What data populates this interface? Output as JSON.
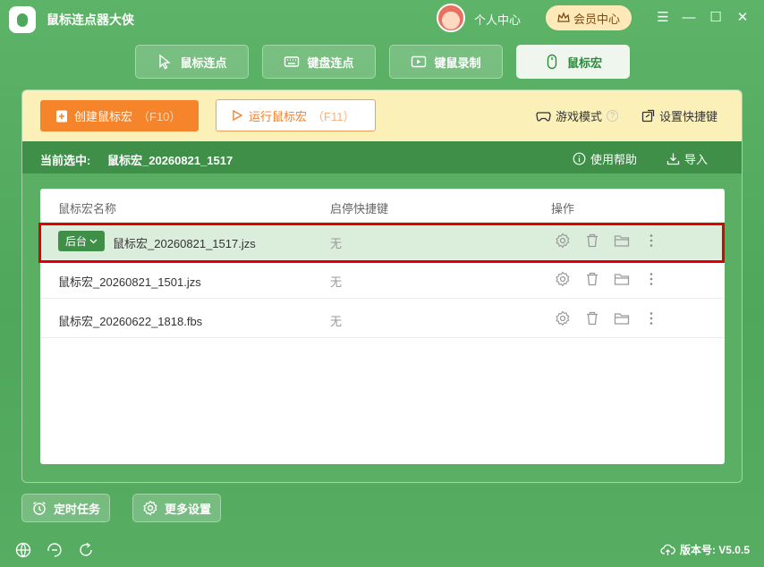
{
  "app": {
    "title": "鼠标连点器大侠",
    "user_center": "个人中心",
    "vip_label": "会员中心"
  },
  "window_controls": {
    "menu": "☰",
    "minimize": "—",
    "maximize": "☐",
    "close": "✕"
  },
  "tabs": [
    {
      "label": "鼠标连点",
      "icon": "cursor-icon"
    },
    {
      "label": "键盘连点",
      "icon": "keyboard-icon"
    },
    {
      "label": "键鼠录制",
      "icon": "video-icon"
    },
    {
      "label": "鼠标宏",
      "icon": "mouse-icon",
      "active": true
    }
  ],
  "toolbar": {
    "create_label": "创建鼠标宏",
    "create_hotkey": "（F10）",
    "run_label": "运行鼠标宏",
    "run_hotkey": "（F11）",
    "game_mode": "游戏模式",
    "game_mode_help": "?",
    "shortcut_settings": "设置快捷键"
  },
  "selection_bar": {
    "label": "当前选中:",
    "value": "鼠标宏_20260821_1517",
    "help": "使用帮助",
    "import": "导入"
  },
  "table": {
    "headers": [
      "鼠标宏名称",
      "启停快捷键",
      "操作"
    ],
    "rows": [
      {
        "badge": "后台",
        "name": "鼠标宏_20260821_1517.jzs",
        "hotkey": "无",
        "selected": true
      },
      {
        "name": "鼠标宏_20260821_1501.jzs",
        "hotkey": "无"
      },
      {
        "name": "鼠标宏_20260622_1818.fbs",
        "hotkey": "无"
      }
    ]
  },
  "bottom": {
    "timer_task": "定时任务",
    "more_settings": "更多设置",
    "version": "版本号: V5.0.5"
  },
  "colors": {
    "brand_green": "#4fa75b",
    "dark_green": "#3f8f49",
    "accent_orange": "#f5842b",
    "highlight_red": "#e00000"
  }
}
